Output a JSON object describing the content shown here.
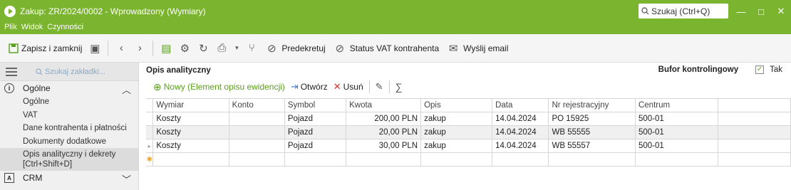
{
  "window": {
    "title": "Zakup: ZR/2024/0002 - Wprowadzony (Wymiary)",
    "search_label": "Szukaj (Ctrl+Q)",
    "minimize": "—",
    "maximize": "□",
    "close": "✕"
  },
  "menu": [
    "Plik",
    "Widok",
    "Czynności"
  ],
  "toolbar": {
    "save_close": "Zapisz i zamknij",
    "predekretuj": "Predekretuj",
    "status_vat": "Status VAT kontrahenta",
    "send_email": "Wyślij email"
  },
  "sidebar": {
    "search_placeholder": "Szukaj zakładki...",
    "section_ogolne": "Ogólne",
    "items": [
      "Ogólne",
      "VAT",
      "Dane kontrahenta i płatności",
      "Dokumenty dodatkowe",
      "Opis analityczny i dekrety",
      "[Ctrl+Shift+D]"
    ],
    "section_crm": "CRM"
  },
  "content": {
    "heading": "Opis analityczny",
    "bufor_label": "Bufor kontrolingowy",
    "bufor_checked": true,
    "bufor_value": "Tak"
  },
  "grid_toolbar": {
    "new": "Nowy (Element opisu ewidencji)",
    "open": "Otwórz",
    "delete": "Usuń"
  },
  "table": {
    "columns": [
      "Wymiar",
      "Konto",
      "Symbol",
      "Kwota",
      "Opis",
      "Data",
      "Nr rejestracyjny",
      "Centrum"
    ],
    "rows": [
      [
        "Koszty",
        "",
        "Pojazd",
        "200,00 PLN",
        "zakup",
        "14.04.2024",
        "PO 15925",
        "500-01"
      ],
      [
        "Koszty",
        "",
        "Pojazd",
        "20,00 PLN",
        "zakup",
        "14.04.2024",
        "WB 55555",
        "500-01"
      ],
      [
        "Koszty",
        "",
        "Pojazd",
        "30,00 PLN",
        "zakup",
        "14.04.2024",
        "WB 55557",
        "500-01"
      ]
    ]
  },
  "colors": {
    "accent": "#7bb52f"
  }
}
